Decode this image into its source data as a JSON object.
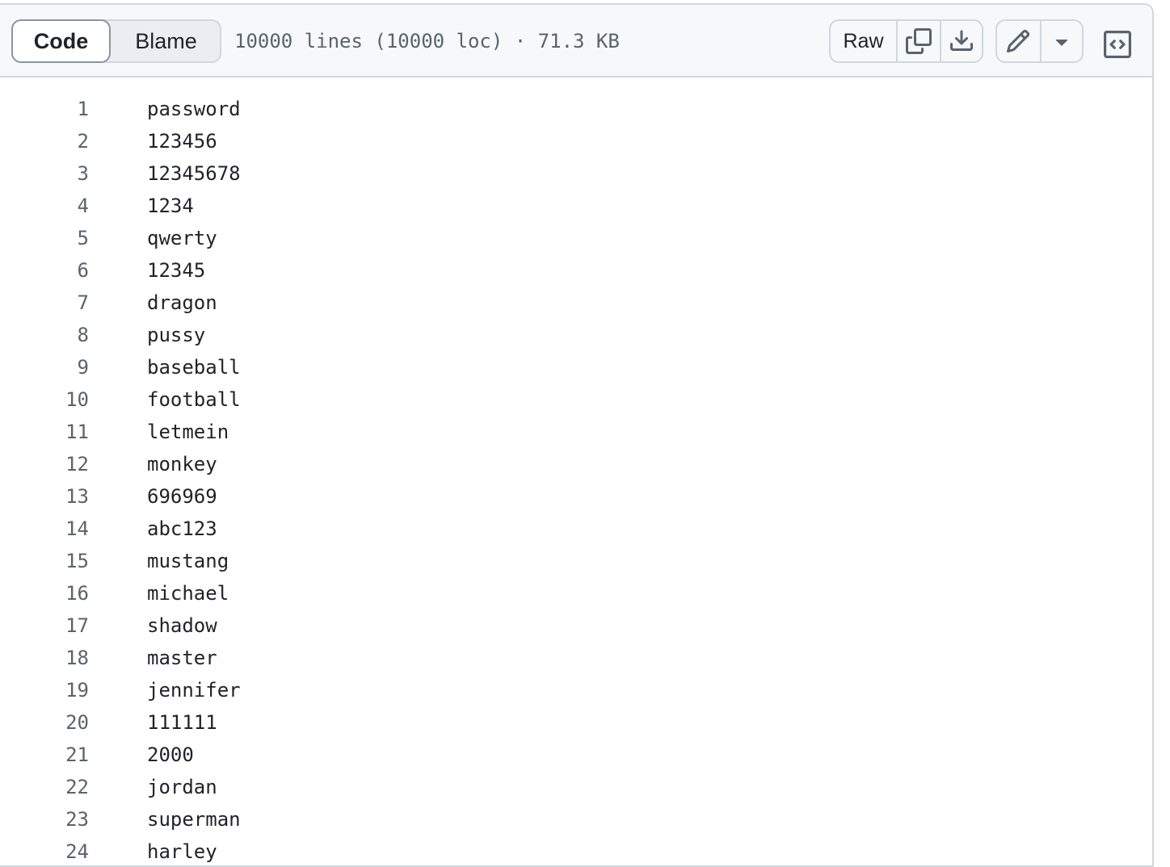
{
  "header": {
    "tabs": [
      {
        "label": "Code",
        "selected": true
      },
      {
        "label": "Blame",
        "selected": false
      }
    ],
    "file_info": "10000 lines (10000 loc) · 71.3 KB",
    "raw_label": "Raw",
    "icons": {
      "copy": "copy-icon",
      "download": "download-icon",
      "edit": "pencil-icon",
      "dropdown": "triangle-down-icon",
      "symbols": "code-square-icon"
    }
  },
  "lines": [
    {
      "num": "1",
      "text": "password"
    },
    {
      "num": "2",
      "text": "123456"
    },
    {
      "num": "3",
      "text": "12345678"
    },
    {
      "num": "4",
      "text": "1234"
    },
    {
      "num": "5",
      "text": "qwerty"
    },
    {
      "num": "6",
      "text": "12345"
    },
    {
      "num": "7",
      "text": "dragon"
    },
    {
      "num": "8",
      "text": "pussy"
    },
    {
      "num": "9",
      "text": "baseball"
    },
    {
      "num": "10",
      "text": "football"
    },
    {
      "num": "11",
      "text": "letmein"
    },
    {
      "num": "12",
      "text": "monkey"
    },
    {
      "num": "13",
      "text": "696969"
    },
    {
      "num": "14",
      "text": "abc123"
    },
    {
      "num": "15",
      "text": "mustang"
    },
    {
      "num": "16",
      "text": "michael"
    },
    {
      "num": "17",
      "text": "shadow"
    },
    {
      "num": "18",
      "text": "master"
    },
    {
      "num": "19",
      "text": "jennifer"
    },
    {
      "num": "20",
      "text": "111111"
    },
    {
      "num": "21",
      "text": "2000"
    },
    {
      "num": "22",
      "text": "jordan"
    },
    {
      "num": "23",
      "text": "superman"
    },
    {
      "num": "24",
      "text": "harley"
    }
  ]
}
